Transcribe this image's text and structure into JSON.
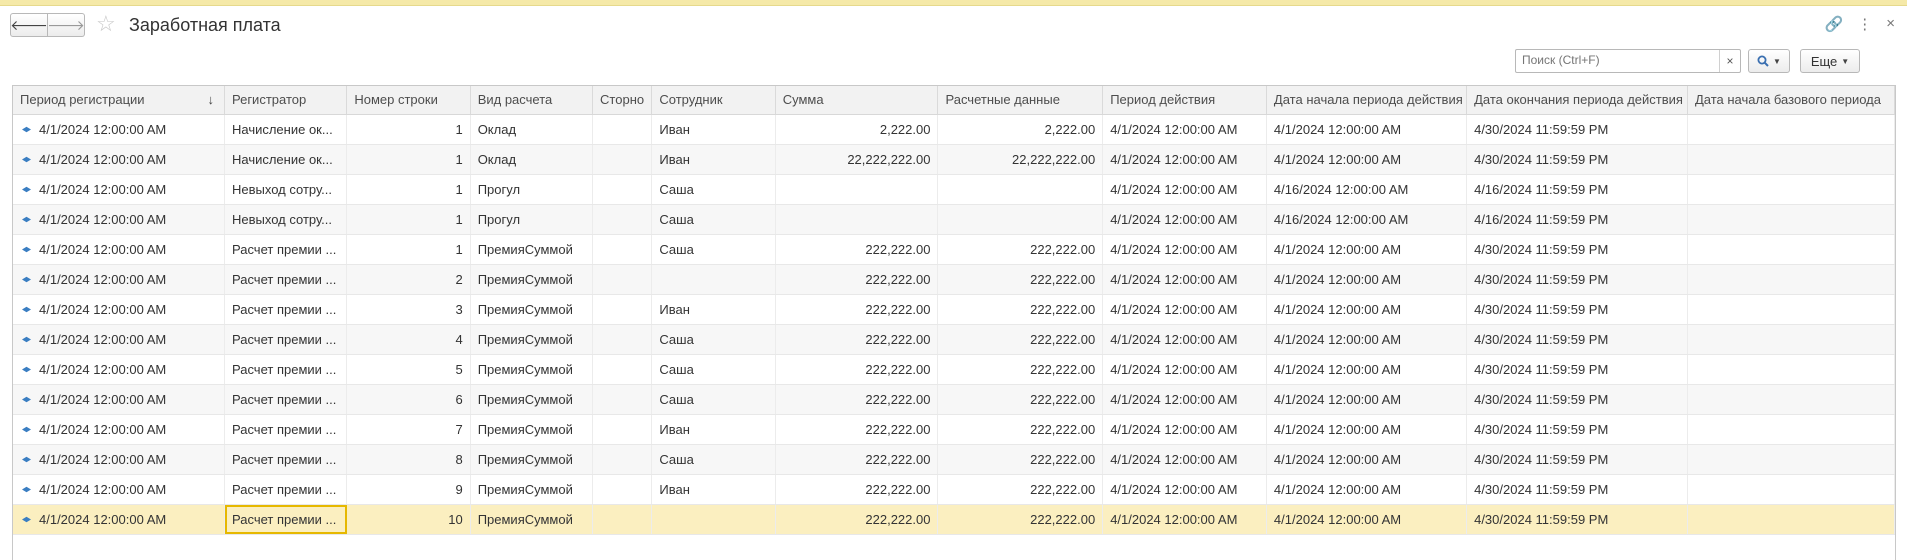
{
  "window": {
    "title": "Заработная плата"
  },
  "search": {
    "placeholder": "Поиск (Ctrl+F)",
    "clear": "×"
  },
  "toolbar": {
    "more_label": "Еще"
  },
  "colors": {
    "accent": "#3a6fb0",
    "selected_row": "#fbefc0",
    "current_cell_border": "#e6b800"
  },
  "table": {
    "sorted_column": "Период регистрации",
    "sort_direction": "descending",
    "columns": [
      "Период регистрации",
      "Регистратор",
      "Номер строки",
      "Вид расчета",
      "Сторно",
      "Сотрудник",
      "Сумма",
      "Расчетные данные",
      "Период действия",
      "Дата начала периода действия",
      "Дата окончания периода действия",
      "Дата начала базового периода"
    ],
    "rows": [
      [
        "4/1/2024 12:00:00 AM",
        "Начисление ок...",
        "1",
        "Оклад",
        "",
        "Иван",
        "2,222.00",
        "2,222.00",
        "4/1/2024 12:00:00 AM",
        "4/1/2024 12:00:00 AM",
        "4/30/2024 11:59:59 PM",
        ""
      ],
      [
        "4/1/2024 12:00:00 AM",
        "Начисление ок...",
        "1",
        "Оклад",
        "",
        "Иван",
        "22,222,222.00",
        "22,222,222.00",
        "4/1/2024 12:00:00 AM",
        "4/1/2024 12:00:00 AM",
        "4/30/2024 11:59:59 PM",
        ""
      ],
      [
        "4/1/2024 12:00:00 AM",
        "Невыход сотру...",
        "1",
        "Прогул",
        "",
        "Саша",
        "",
        "",
        "4/1/2024 12:00:00 AM",
        "4/16/2024 12:00:00 AM",
        "4/16/2024 11:59:59 PM",
        ""
      ],
      [
        "4/1/2024 12:00:00 AM",
        "Невыход сотру...",
        "1",
        "Прогул",
        "",
        "Саша",
        "",
        "",
        "4/1/2024 12:00:00 AM",
        "4/16/2024 12:00:00 AM",
        "4/16/2024 11:59:59 PM",
        ""
      ],
      [
        "4/1/2024 12:00:00 AM",
        "Расчет премии ...",
        "1",
        "ПремияСуммой",
        "",
        "Саша",
        "222,222.00",
        "222,222.00",
        "4/1/2024 12:00:00 AM",
        "4/1/2024 12:00:00 AM",
        "4/30/2024 11:59:59 PM",
        ""
      ],
      [
        "4/1/2024 12:00:00 AM",
        "Расчет премии ...",
        "2",
        "ПремияСуммой",
        "",
        "",
        "222,222.00",
        "222,222.00",
        "4/1/2024 12:00:00 AM",
        "4/1/2024 12:00:00 AM",
        "4/30/2024 11:59:59 PM",
        ""
      ],
      [
        "4/1/2024 12:00:00 AM",
        "Расчет премии ...",
        "3",
        "ПремияСуммой",
        "",
        "Иван",
        "222,222.00",
        "222,222.00",
        "4/1/2024 12:00:00 AM",
        "4/1/2024 12:00:00 AM",
        "4/30/2024 11:59:59 PM",
        ""
      ],
      [
        "4/1/2024 12:00:00 AM",
        "Расчет премии ...",
        "4",
        "ПремияСуммой",
        "",
        "Саша",
        "222,222.00",
        "222,222.00",
        "4/1/2024 12:00:00 AM",
        "4/1/2024 12:00:00 AM",
        "4/30/2024 11:59:59 PM",
        ""
      ],
      [
        "4/1/2024 12:00:00 AM",
        "Расчет премии ...",
        "5",
        "ПремияСуммой",
        "",
        "Саша",
        "222,222.00",
        "222,222.00",
        "4/1/2024 12:00:00 AM",
        "4/1/2024 12:00:00 AM",
        "4/30/2024 11:59:59 PM",
        ""
      ],
      [
        "4/1/2024 12:00:00 AM",
        "Расчет премии ...",
        "6",
        "ПремияСуммой",
        "",
        "Саша",
        "222,222.00",
        "222,222.00",
        "4/1/2024 12:00:00 AM",
        "4/1/2024 12:00:00 AM",
        "4/30/2024 11:59:59 PM",
        ""
      ],
      [
        "4/1/2024 12:00:00 AM",
        "Расчет премии ...",
        "7",
        "ПремияСуммой",
        "",
        "Иван",
        "222,222.00",
        "222,222.00",
        "4/1/2024 12:00:00 AM",
        "4/1/2024 12:00:00 AM",
        "4/30/2024 11:59:59 PM",
        ""
      ],
      [
        "4/1/2024 12:00:00 AM",
        "Расчет премии ...",
        "8",
        "ПремияСуммой",
        "",
        "Саша",
        "222,222.00",
        "222,222.00",
        "4/1/2024 12:00:00 AM",
        "4/1/2024 12:00:00 AM",
        "4/30/2024 11:59:59 PM",
        ""
      ],
      [
        "4/1/2024 12:00:00 AM",
        "Расчет премии ...",
        "9",
        "ПремияСуммой",
        "",
        "Иван",
        "222,222.00",
        "222,222.00",
        "4/1/2024 12:00:00 AM",
        "4/1/2024 12:00:00 AM",
        "4/30/2024 11:59:59 PM",
        ""
      ],
      [
        "4/1/2024 12:00:00 AM",
        "Расчет премии ...",
        "10",
        "ПремияСуммой",
        "",
        "",
        "222,222.00",
        "222,222.00",
        "4/1/2024 12:00:00 AM",
        "4/1/2024 12:00:00 AM",
        "4/30/2024 11:59:59 PM",
        ""
      ]
    ]
  }
}
